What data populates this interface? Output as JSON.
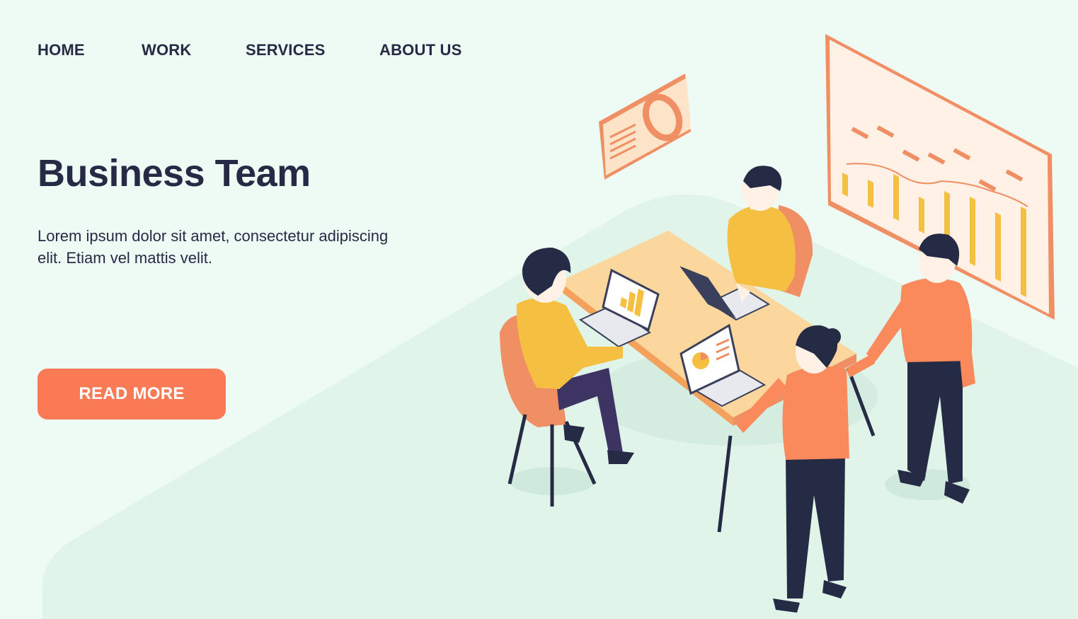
{
  "nav": {
    "items": [
      {
        "label": "HOME"
      },
      {
        "label": "WORK"
      },
      {
        "label": "SERVICES"
      },
      {
        "label": "ABOUT US"
      }
    ]
  },
  "hero": {
    "title": "Business Team",
    "description": "Lorem ipsum dolor sit amet, consectetur adipiscing elit. Etiam vel mattis velit.",
    "cta_label": "READ MORE"
  },
  "colors": {
    "background": "#eefaf4",
    "text": "#262b45",
    "accent": "#fa7a56",
    "yellow": "#f5bf42",
    "table": "#fbd79e"
  }
}
